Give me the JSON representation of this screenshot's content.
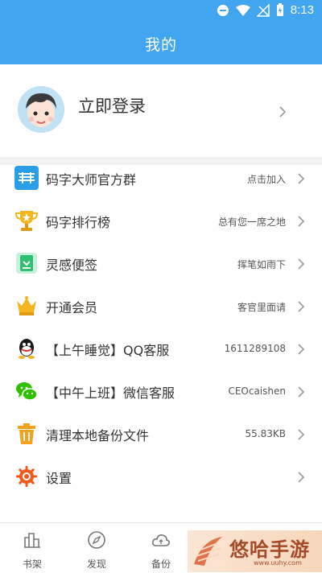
{
  "status_bar": {
    "time": "8:13"
  },
  "header": {
    "title": "我的"
  },
  "login": {
    "label": "立即登录"
  },
  "menu": [
    {
      "label": "码字大师官方群",
      "value": "点击加入",
      "icon": "group-logo-icon"
    },
    {
      "label": "码字排行榜",
      "value": "总有您一席之地",
      "icon": "trophy-icon"
    },
    {
      "label": "灵感便签",
      "value": "挥笔如雨下",
      "icon": "note-icon"
    },
    {
      "label": "开通会员",
      "value": "客官里面请",
      "icon": "crown-icon"
    },
    {
      "label": "【上午睡觉】QQ客服",
      "value": "1611289108",
      "icon": "qq-icon"
    },
    {
      "label": "【中午上班】微信客服",
      "value": "CEOcaishen",
      "icon": "wechat-icon"
    },
    {
      "label": "清理本地备份文件",
      "value": "55.83KB",
      "icon": "trash-icon"
    },
    {
      "label": "设置",
      "value": "",
      "icon": "settings-icon"
    }
  ],
  "tabbar": [
    {
      "label": "书架",
      "icon": "bookshelf-icon"
    },
    {
      "label": "发现",
      "icon": "compass-icon"
    },
    {
      "label": "备份",
      "icon": "cloud-backup-icon"
    },
    {
      "label": "",
      "icon": ""
    },
    {
      "label": "",
      "icon": ""
    }
  ],
  "watermark": {
    "text": "悠哈手游",
    "sub": "www.uuhy.com"
  },
  "colors": {
    "primary": "#42a5f0",
    "separator": "#f2f2f2",
    "chevron": "#999999"
  }
}
